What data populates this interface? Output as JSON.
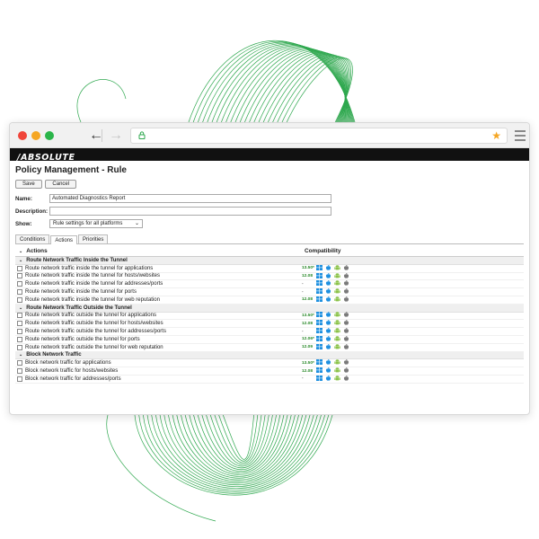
{
  "browser": {
    "back_glyph": "←",
    "forward_glyph": "→",
    "bookmark_glyph": "★"
  },
  "brand": {
    "logo_text": "/ABSOLUTE"
  },
  "page": {
    "title": "Policy Management - Rule"
  },
  "buttons": {
    "save": "Save",
    "cancel": "Cancel"
  },
  "form": {
    "name_label": "Name:",
    "name_value": "Automated Diagnostics Report",
    "description_label": "Description:",
    "description_value": "",
    "show_label": "Show:",
    "show_value": "Rule settings for all platforms"
  },
  "tabs": [
    {
      "label": "Conditions",
      "active": false
    },
    {
      "label": "Actions",
      "active": true
    },
    {
      "label": "Priorities",
      "active": false
    }
  ],
  "table": {
    "actions_header": "Actions",
    "compat_header": "Compatibility",
    "groups": [
      {
        "title": "Route Network Traffic Inside the Tunnel",
        "items": [
          {
            "label": "Route network traffic inside the tunnel for applications",
            "version": "13.50*"
          },
          {
            "label": "Route network traffic inside the tunnel for hosts/websites",
            "version": "12.08"
          },
          {
            "label": "Route network traffic inside the tunnel for addresses/ports",
            "version": "-"
          },
          {
            "label": "Route network traffic inside the tunnel for ports",
            "version": "-"
          },
          {
            "label": "Route network traffic inside the tunnel for web reputation",
            "version": "12.08"
          }
        ]
      },
      {
        "title": "Route Network Traffic Outside the Tunnel",
        "items": [
          {
            "label": "Route network traffic outside the tunnel for applications",
            "version": "13.50*"
          },
          {
            "label": "Route network traffic outside the tunnel for hosts/websites",
            "version": "12.08"
          },
          {
            "label": "Route network traffic outside the tunnel for addresses/ports",
            "version": "-"
          },
          {
            "label": "Route network traffic outside the tunnel for ports",
            "version": "12.06*"
          },
          {
            "label": "Route network traffic outside the tunnel for web reputation",
            "version": "12.09"
          }
        ]
      },
      {
        "title": "Block Network Traffic",
        "items": [
          {
            "label": "Block network traffic for applications",
            "version": "13.50*"
          },
          {
            "label": "Block network traffic for hosts/websites",
            "version": "12.08"
          },
          {
            "label": "Block network traffic for addresses/ports",
            "version": "-"
          }
        ]
      }
    ]
  },
  "colors": {
    "accent_green": "#2fa84f",
    "windows_blue": "#1e90e0",
    "android_green": "#8bc34a",
    "apple_grey": "#7a7a7a"
  }
}
